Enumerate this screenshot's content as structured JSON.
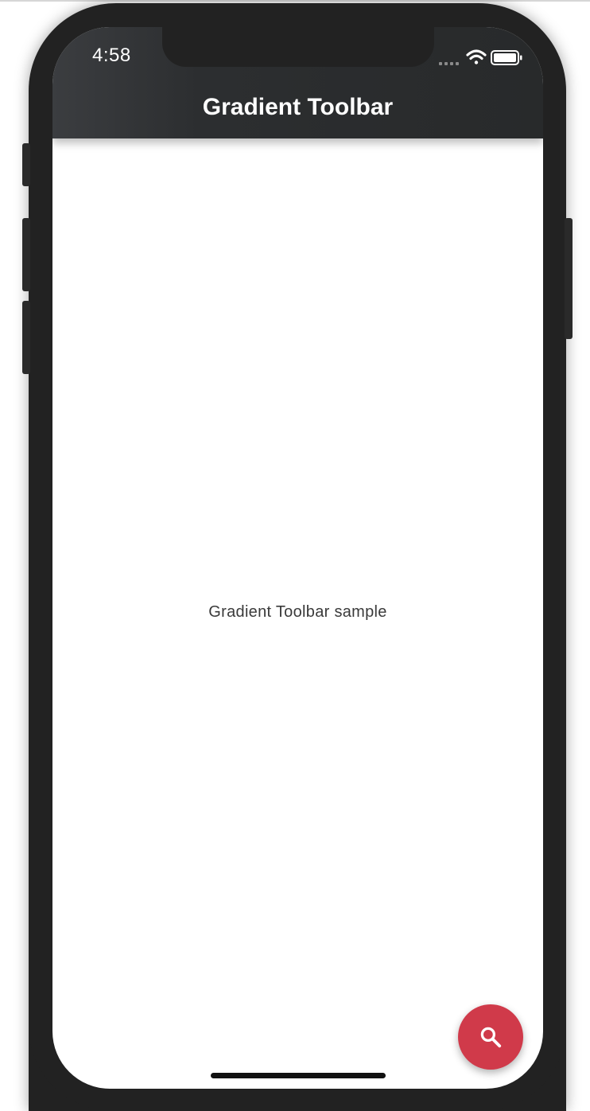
{
  "status_bar": {
    "time": "4:58",
    "icons": [
      "signal-dots-icon",
      "wifi-icon",
      "battery-icon"
    ]
  },
  "app_bar": {
    "title": "Gradient Toolbar",
    "gradient_colors": [
      "#3b3d40",
      "#282a2b"
    ]
  },
  "body": {
    "text": "Gradient Toolbar sample"
  },
  "fab": {
    "icon": "search-icon",
    "color": "#d03a4a"
  }
}
